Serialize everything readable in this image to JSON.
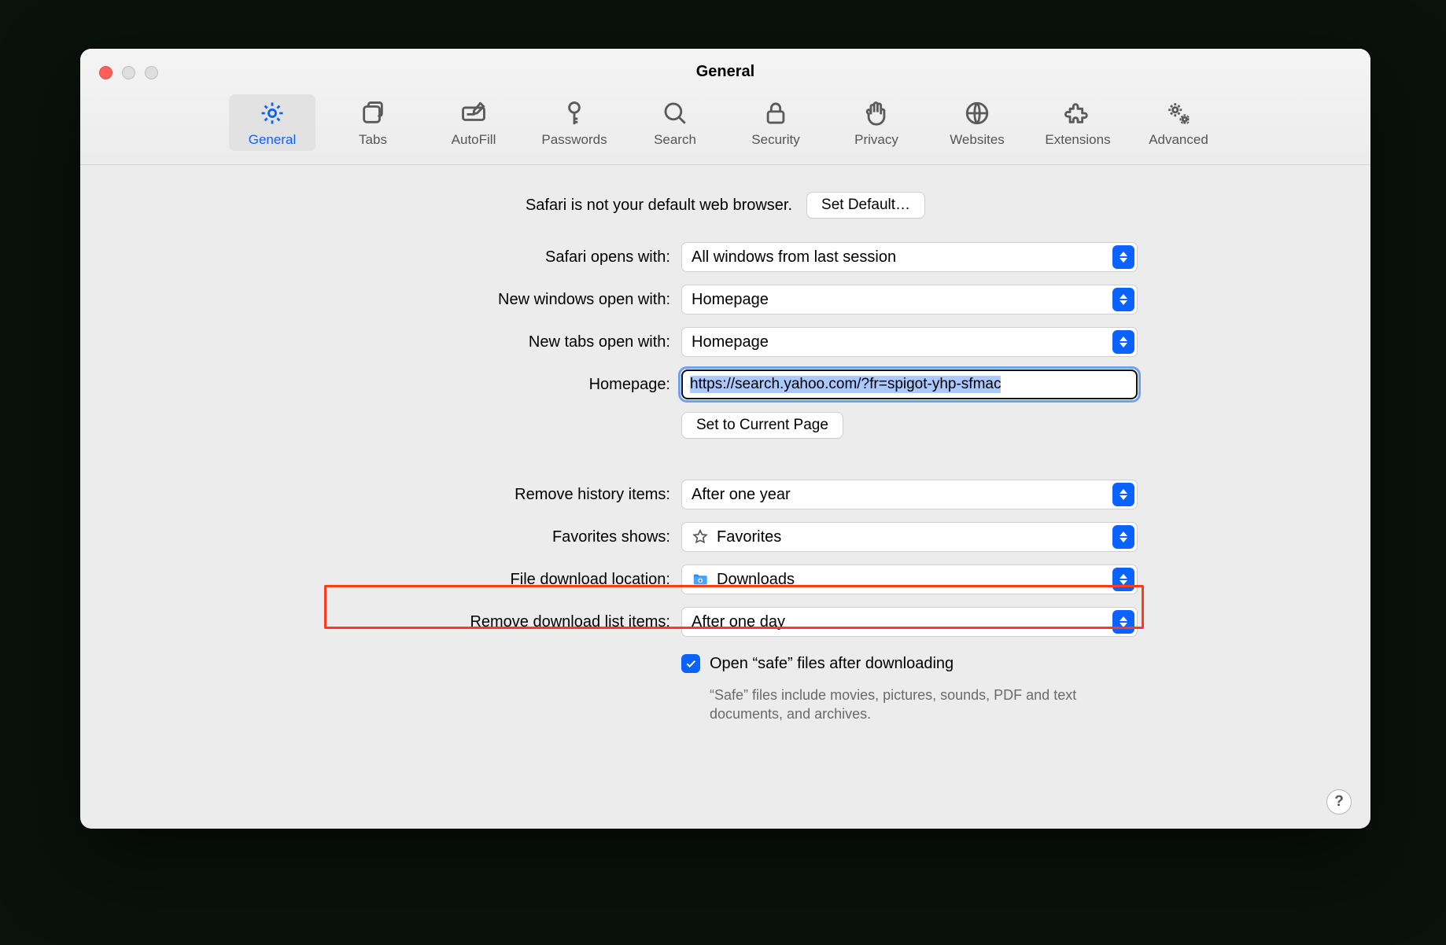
{
  "window": {
    "title": "General"
  },
  "toolbar": {
    "items": [
      {
        "id": "general",
        "label": "General"
      },
      {
        "id": "tabs",
        "label": "Tabs"
      },
      {
        "id": "autofill",
        "label": "AutoFill"
      },
      {
        "id": "passwords",
        "label": "Passwords"
      },
      {
        "id": "search",
        "label": "Search"
      },
      {
        "id": "security",
        "label": "Security"
      },
      {
        "id": "privacy",
        "label": "Privacy"
      },
      {
        "id": "websites",
        "label": "Websites"
      },
      {
        "id": "extensions",
        "label": "Extensions"
      },
      {
        "id": "advanced",
        "label": "Advanced"
      }
    ]
  },
  "defaultBrowser": {
    "message": "Safari is not your default web browser.",
    "button": "Set Default…"
  },
  "labels": {
    "opensWith": "Safari opens with:",
    "newWindows": "New windows open with:",
    "newTabs": "New tabs open with:",
    "homepage": "Homepage:",
    "setCurrent": "Set to Current Page",
    "removeHistory": "Remove history items:",
    "favorites": "Favorites shows:",
    "downloadLocation": "File download location:",
    "removeDownloads": "Remove download list items:",
    "openSafe": "Open “safe” files after downloading",
    "safeDesc": "“Safe” files include movies, pictures, sounds, PDF and text documents, and archives."
  },
  "values": {
    "opensWith": "All windows from last session",
    "newWindows": "Homepage",
    "newTabs": "Homepage",
    "homepage": "https://search.yahoo.com/?fr=spigot-yhp-sfmac",
    "removeHistory": "After one year",
    "favorites": "Favorites",
    "downloadLocation": "Downloads",
    "removeDownloads": "After one day",
    "openSafeChecked": true
  },
  "help": "?"
}
